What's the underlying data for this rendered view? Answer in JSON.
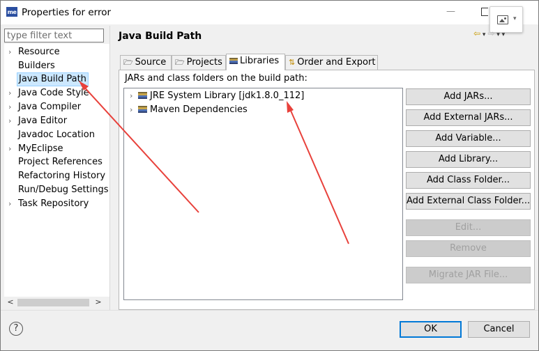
{
  "window": {
    "title": "Properties for error",
    "logo_text": "me"
  },
  "left": {
    "filter_placeholder": "type filter text",
    "tree": [
      {
        "label": "Resource",
        "expandable": true,
        "selected": false
      },
      {
        "label": "Builders",
        "expandable": false,
        "selected": false
      },
      {
        "label": "Java Build Path",
        "expandable": false,
        "selected": true
      },
      {
        "label": "Java Code Style",
        "expandable": true,
        "selected": false
      },
      {
        "label": "Java Compiler",
        "expandable": true,
        "selected": false
      },
      {
        "label": "Java Editor",
        "expandable": true,
        "selected": false
      },
      {
        "label": "Javadoc Location",
        "expandable": false,
        "selected": false
      },
      {
        "label": "MyEclipse",
        "expandable": true,
        "selected": false
      },
      {
        "label": "Project References",
        "expandable": false,
        "selected": false
      },
      {
        "label": "Refactoring History",
        "expandable": false,
        "selected": false
      },
      {
        "label": "Run/Debug Settings",
        "expandable": false,
        "selected": false
      },
      {
        "label": "Task Repository",
        "expandable": true,
        "selected": false
      }
    ]
  },
  "main": {
    "title": "Java Build Path",
    "tabs": [
      {
        "label": "Source",
        "icon": "source-folder-icon"
      },
      {
        "label": "Projects",
        "icon": "projects-icon"
      },
      {
        "label": "Libraries",
        "icon": "libraries-icon",
        "active": true
      },
      {
        "label": "Order and Export",
        "icon": "order-export-icon"
      }
    ],
    "subtitle": "JARs and class folders on the build path:",
    "libraries": [
      {
        "label": "JRE System Library [jdk1.8.0_112]"
      },
      {
        "label": "Maven Dependencies"
      }
    ],
    "buttons": {
      "add_jars": "Add JARs...",
      "add_external_jars": "Add External JARs...",
      "add_variable": "Add Variable...",
      "add_library": "Add Library...",
      "add_class_folder": "Add Class Folder...",
      "add_external_class_folder": "Add External Class Folder...",
      "edit": "Edit...",
      "remove": "Remove",
      "migrate_jar": "Migrate JAR File..."
    }
  },
  "footer": {
    "help": "?",
    "ok": "OK",
    "cancel": "Cancel"
  },
  "colors": {
    "annotation_arrow": "#e8413b",
    "selection": "#cce8ff",
    "default_button_border": "#0078d7"
  }
}
